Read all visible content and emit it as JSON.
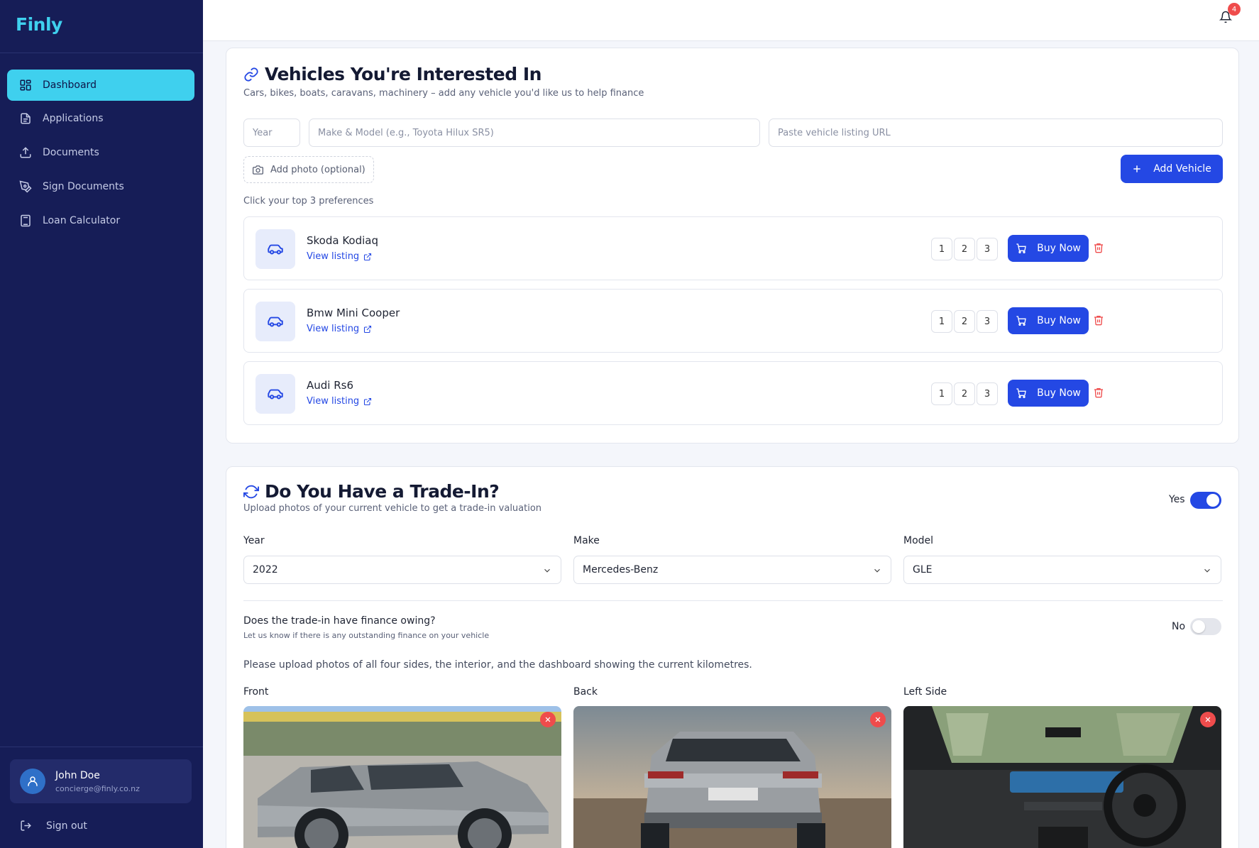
{
  "brand": {
    "logo": "Finly"
  },
  "nav": {
    "items": [
      {
        "label": "Dashboard",
        "icon": "dashboard-icon",
        "active": true
      },
      {
        "label": "Applications",
        "icon": "file-icon"
      },
      {
        "label": "Documents",
        "icon": "upload-icon"
      },
      {
        "label": "Sign Documents",
        "icon": "pen-icon"
      },
      {
        "label": "Loan Calculator",
        "icon": "calculator-icon"
      }
    ]
  },
  "user": {
    "name": "John Doe",
    "email": "concierge@finly.co.nz",
    "signout": "Sign out"
  },
  "topbar": {
    "notification_count": "4"
  },
  "vehicles": {
    "title": "Vehicles You're Interested In",
    "subtitle": "Cars, bikes, boats, caravans, machinery – add any vehicle you'd like us to help finance",
    "year_placeholder": "Year",
    "make_placeholder": "Make & Model (e.g., Toyota Hilux SR5)",
    "url_placeholder": "Paste vehicle listing URL",
    "add_photo": "Add photo (optional)",
    "add_button": "Add Vehicle",
    "pref_label": "Click your top 3 preferences",
    "list": [
      {
        "name": "Skoda Kodiaq",
        "link": "View listing",
        "ranks": [
          "1",
          "2",
          "3"
        ],
        "buy": "Buy Now"
      },
      {
        "name": "Bmw Mini Cooper",
        "link": "View listing",
        "ranks": [
          "1",
          "2",
          "3"
        ],
        "buy": "Buy Now"
      },
      {
        "name": "Audi Rs6",
        "link": "View listing",
        "ranks": [
          "1",
          "2",
          "3"
        ],
        "buy": "Buy Now"
      }
    ]
  },
  "tradein": {
    "title": "Do You Have a Trade-In?",
    "subtitle": "Upload photos of your current vehicle to get a trade-in valuation",
    "toggle_label": "Yes",
    "toggle_on": true,
    "fields": [
      {
        "label": "Year",
        "value": "2022"
      },
      {
        "label": "Make",
        "value": "Mercedes-Benz"
      },
      {
        "label": "Model",
        "value": "GLE"
      }
    ],
    "finance_question": "Does the trade-in have finance owing?",
    "finance_sub": "Let us know if there is any outstanding finance on your vehicle",
    "finance_toggle_label": "No",
    "finance_on": false,
    "instructions": "Please upload photos of all four sides, the interior, and the dashboard showing the current kilometres.",
    "photos": [
      {
        "label": "Front"
      },
      {
        "label": "Back"
      },
      {
        "label": "Left Side"
      }
    ]
  },
  "colors": {
    "sidebar": "#161d57",
    "accent": "#3fd0ee",
    "primary": "#2448e4",
    "danger": "#ef4c4c"
  }
}
